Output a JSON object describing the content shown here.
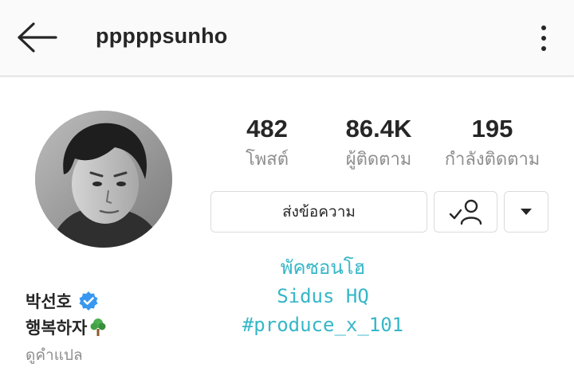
{
  "header": {
    "username": "pppppsunho",
    "back_icon": "arrow-left-icon",
    "more_icon": "more-vertical-icon"
  },
  "profile": {
    "avatar_icon": "profile-photo",
    "stats": [
      {
        "value": "482",
        "label": "โพสต์"
      },
      {
        "value": "86.4K",
        "label": "ผู้ติดตาม"
      },
      {
        "value": "195",
        "label": "กำลังติดตาม"
      }
    ],
    "message_button_label": "ส่งข้อความ",
    "following_icon": "person-check-icon",
    "dropdown_icon": "caret-down-icon",
    "bio_center_lines": [
      "พัคซอนโฮ",
      "Sidus HQ",
      "#produce_x_101"
    ],
    "full_name": "박선호",
    "verified_icon": "verified-badge-icon",
    "bio_text": "행복하자",
    "tree_icon": "tree-emoji-icon",
    "translate_label": "ดูคำแปล"
  },
  "colors": {
    "accent_bio": "#36b7c8",
    "verified": "#3897f0",
    "text_primary": "#262626",
    "text_secondary": "#8e8e8e"
  }
}
